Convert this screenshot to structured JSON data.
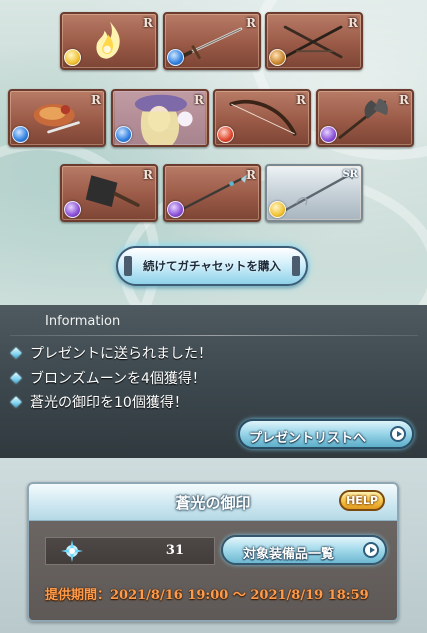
{
  "draw_results": [
    {
      "rarity": "R",
      "item": "flame",
      "element": "light",
      "element_color": "#f1c232"
    },
    {
      "rarity": "R",
      "item": "sword",
      "element": "water",
      "element_color": "#2f7fe0"
    },
    {
      "rarity": "R",
      "item": "crossed-blades",
      "element": "earth",
      "element_color": "#c9852b"
    },
    {
      "rarity": "R",
      "item": "food",
      "element": "water",
      "element_color": "#2f7fe0"
    },
    {
      "rarity": "R",
      "item": "character",
      "element": "water",
      "element_color": "#2f7fe0"
    },
    {
      "rarity": "R",
      "item": "bow",
      "element": "fire",
      "element_color": "#e0452b"
    },
    {
      "rarity": "R",
      "item": "axe",
      "element": "dark",
      "element_color": "#8a4fd6"
    },
    {
      "rarity": "R",
      "item": "cleaver",
      "element": "dark",
      "element_color": "#8a4fd6"
    },
    {
      "rarity": "R",
      "item": "spear",
      "element": "dark",
      "element_color": "#8a4fd6"
    },
    {
      "rarity": "SR",
      "item": "silver-spear",
      "element": "light",
      "element_color": "#f1c232"
    }
  ],
  "gacha_button": {
    "label": "続けてガチャセットを購入"
  },
  "information": {
    "title": "Information",
    "messages": [
      "プレゼントに送られました！",
      "ブロンズムーンを4個獲得！",
      "蒼光の御印を10個獲得！"
    ],
    "present_button": "プレゼントリストへ"
  },
  "seal_panel": {
    "title": "蒼光の御印",
    "help_label": "HELP",
    "count": "31",
    "target_button": "対象装備品一覧",
    "period": "提供期間：2021/8/16 19:00 ～ 2021/8/19 18:59"
  },
  "colors": {
    "card_border": "#6b3b2e",
    "button_glow": "#6edcff",
    "period_text": "#ff9b4a",
    "help_gold": "#f6c64a"
  }
}
